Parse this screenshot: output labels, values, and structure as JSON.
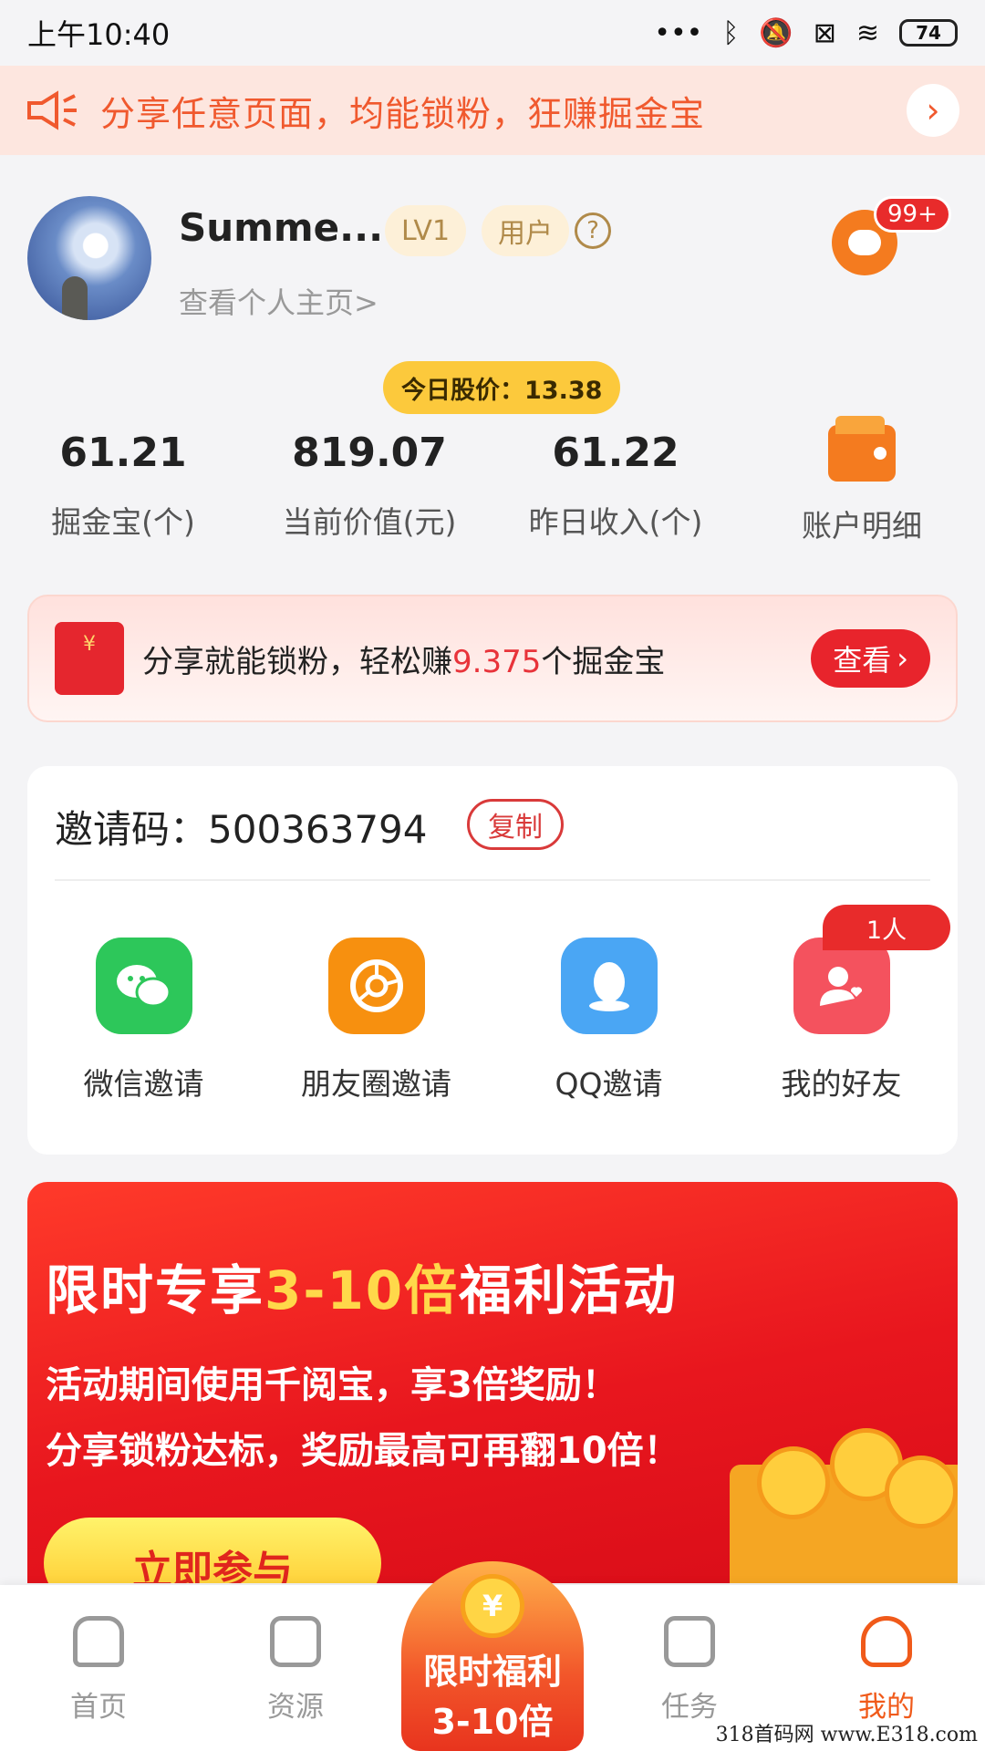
{
  "status_bar": {
    "time": "上午10:40",
    "battery": "74"
  },
  "notice": {
    "text": "分享任意页面，均能锁粉，狂赚掘金宝"
  },
  "profile": {
    "username": "Summe...",
    "level": "LV1",
    "role": "用户",
    "help": "?",
    "homepage_link": "查看个人主页>",
    "message_badge": "99+"
  },
  "stock": {
    "label": "今日股价：13.38"
  },
  "stats": [
    {
      "value": "61.21",
      "label": "掘金宝(个)"
    },
    {
      "value": "819.07",
      "label": "当前价值(元)"
    },
    {
      "value": "61.22",
      "label": "昨日收入(个)"
    },
    {
      "value": "",
      "label": "账户明细"
    }
  ],
  "promo": {
    "text_before": "分享就能锁粉，轻松赚",
    "highlight": "9.375",
    "text_after": "个掘金宝",
    "button": "查看"
  },
  "invite": {
    "code_label": "邀请码：500363794",
    "copy_button": "复制",
    "friends_badge": "1人",
    "items": [
      {
        "label": "微信邀请",
        "icon": "wechat-icon",
        "color": "#2dc75a"
      },
      {
        "label": "朋友圈邀请",
        "icon": "moments-icon",
        "color": "#f7900f"
      },
      {
        "label": "QQ邀请",
        "icon": "qq-icon",
        "color": "#4aa6f4"
      },
      {
        "label": "我的好友",
        "icon": "friends-icon",
        "color": "#f4525e"
      }
    ]
  },
  "campaign": {
    "title_before": "限时专享",
    "title_highlight": "3-10倍",
    "title_after": "福利活动",
    "line1": "活动期间使用千阅宝，享3倍奖励！",
    "line2": "分享锁粉达标，奖励最高可再翻10倍！",
    "button": "立即参与"
  },
  "bottom_nav": {
    "items": [
      "首页",
      "资源",
      "任务",
      "我的"
    ],
    "center_line1": "限时福利",
    "center_line2": "3-10倍",
    "center_coin": "¥"
  },
  "watermark": "318首码网 www.E318.com",
  "colors": {
    "accent": "#f05a1a",
    "red": "#e8242c",
    "gold": "#fcc93c"
  }
}
